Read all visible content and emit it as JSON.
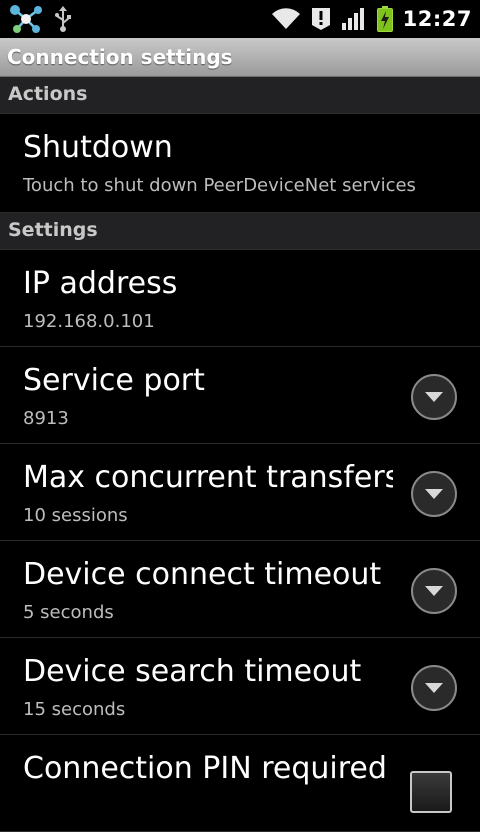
{
  "status_bar": {
    "time": "12:27",
    "left_icons": [
      "peerdevicenet-app-icon",
      "usb-icon"
    ],
    "right_icons": [
      "wifi-icon",
      "alert-icon",
      "signal-icon",
      "battery-charging-icon"
    ]
  },
  "title_bar": {
    "title": "Connection settings"
  },
  "sections": [
    {
      "header": "Actions",
      "items": [
        {
          "title": "Shutdown",
          "summary": "Touch to shut down PeerDeviceNet services",
          "widget": "none"
        }
      ]
    },
    {
      "header": "Settings",
      "items": [
        {
          "title": "IP address",
          "summary": "192.168.0.101",
          "widget": "none"
        },
        {
          "title": "Service port",
          "summary": "8913",
          "widget": "dropdown"
        },
        {
          "title": "Max concurrent transfers",
          "summary": "10 sessions",
          "widget": "dropdown"
        },
        {
          "title": "Device connect timeout",
          "summary": "5 seconds",
          "widget": "dropdown"
        },
        {
          "title": "Device search timeout",
          "summary": "15 seconds",
          "widget": "dropdown"
        },
        {
          "title": "Connection PIN required",
          "summary": "",
          "widget": "checkbox",
          "checked": false
        }
      ]
    }
  ]
}
